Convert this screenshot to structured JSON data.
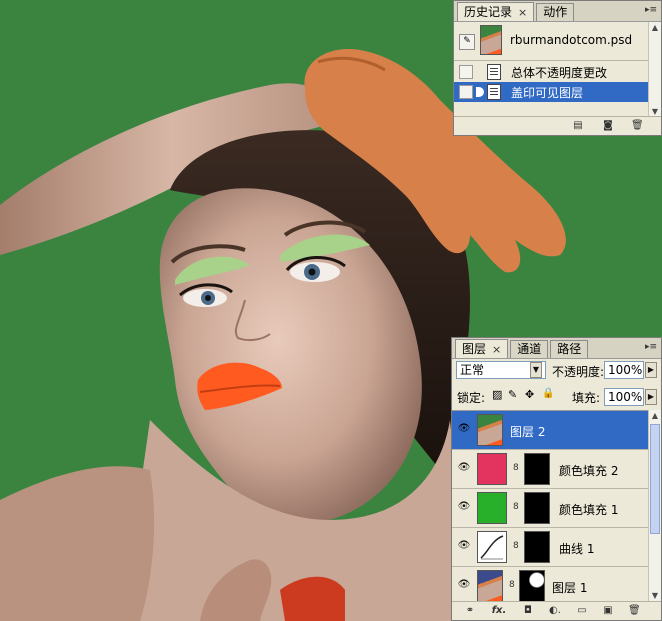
{
  "history_panel": {
    "tabs": [
      {
        "label": "历史记录",
        "close_glyph": "×",
        "active": true
      },
      {
        "label": "动作",
        "close_glyph": "",
        "active": false
      }
    ],
    "menu_glyph": "▸≡",
    "snapshot_name": "rburmandotcom.psd",
    "states": [
      {
        "label": "总体不透明度更改",
        "selected": false
      },
      {
        "label": "盖印可见图层",
        "selected": true
      }
    ],
    "footer_icons": [
      "new-document-from-state-icon",
      "camera-snapshot-icon",
      "trash-icon"
    ],
    "footer_glyphs": [
      "▤",
      "◙",
      "🗑"
    ]
  },
  "layers_panel": {
    "tabs": [
      {
        "label": "图层",
        "close_glyph": "×",
        "active": true
      },
      {
        "label": "通道",
        "close_glyph": "",
        "active": false
      },
      {
        "label": "路径",
        "close_glyph": "",
        "active": false
      }
    ],
    "menu_glyph": "▸≡",
    "blend_mode": "正常",
    "opacity_label": "不透明度:",
    "opacity_value": "100%",
    "lock_label": "锁定:",
    "lock_glyphs": [
      "▨",
      "✎",
      "✥",
      "🔒"
    ],
    "fill_label": "填充:",
    "fill_value": "100%",
    "arrow_glyph": "▶",
    "dropdown_glyph": "▼",
    "layers": [
      {
        "name": "图层 2",
        "thumb": "photo",
        "color": "#3a8440",
        "mask": false,
        "selected": true
      },
      {
        "name": "颜色填充 2",
        "thumb": "solid",
        "color": "#e2345f",
        "mask": true,
        "selected": false
      },
      {
        "name": "颜色填充 1",
        "thumb": "solid",
        "color": "#28b02a",
        "mask": true,
        "selected": false
      },
      {
        "name": "曲线 1",
        "thumb": "curves",
        "color": "#ffffff",
        "mask": true,
        "selected": false
      },
      {
        "name": "图层 1",
        "thumb": "photo",
        "color": "#3a8440",
        "mask": true,
        "selected": false
      }
    ],
    "eye_glyph": "👁",
    "chain_glyph": "8",
    "footer_glyphs": [
      "⚭",
      "fx.",
      "◘",
      "◐.",
      "▭",
      "▣",
      "🗑"
    ]
  },
  "colors": {
    "canvas_bg": "#3a8440",
    "selection": "#316ac5",
    "panel_bg": "#ece9d8",
    "glove": "#d8804a",
    "lips": "#ff5a1f",
    "eyeshadow": "#a8d28a"
  }
}
